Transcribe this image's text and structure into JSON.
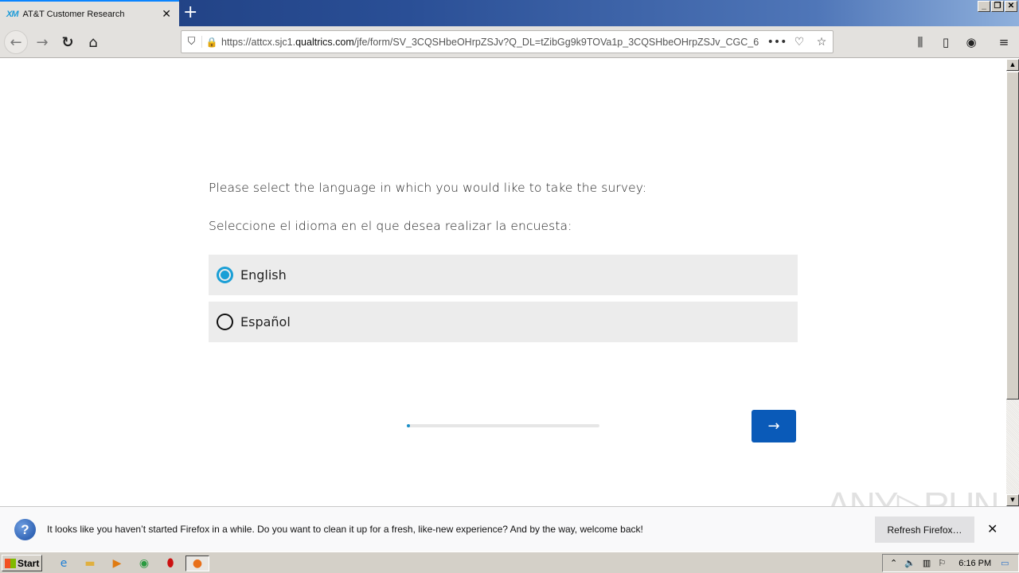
{
  "browser": {
    "tab": {
      "favicon_text": "XM",
      "title": "AT&T Customer Research",
      "close_glyph": "✕"
    },
    "new_tab_glyph": "+",
    "window_controls": {
      "minimize": "_",
      "restore": "❐",
      "close": "✕"
    },
    "nav": {
      "back_glyph": "←",
      "forward_glyph": "→",
      "reload_glyph": "↻",
      "home_glyph": "⌂"
    },
    "url": {
      "prefix": "https://attcx.sjc1.",
      "domain": "qualtrics.com",
      "path": "/jfe/form/SV_3CQSHbeOHrpZSJv?Q_DL=tZibGg9k9TOVa1p_3CQSHbeOHrpZSJv_CGC_6",
      "shield_glyph": "⛉",
      "lock_glyph": "🔒",
      "more_glyph": "•••",
      "pocket_glyph": "♡",
      "star_glyph": "☆"
    },
    "toolbar_right": {
      "library_glyph": "⫼",
      "sidebar_glyph": "▯",
      "account_glyph": "◉",
      "menu_glyph": "≡"
    }
  },
  "survey": {
    "question_en": "Please select the language in which you would like to take the survey:",
    "question_es": "Seleccione el idioma en el que desea realizar la encuesta:",
    "choices": [
      {
        "label": "English",
        "selected": true
      },
      {
        "label": "Español",
        "selected": false
      }
    ],
    "progress_percent": 1,
    "next_glyph": "→",
    "accent_color": "#1a9fd6",
    "button_color": "#0a5ab8"
  },
  "notification": {
    "icon_glyph": "?",
    "message": "It looks like you haven’t started Firefox in a while. Do you want to clean it up for a fresh, like-new experience? And by the way, welcome back!",
    "button_label": "Refresh Firefox…",
    "close_glyph": "✕"
  },
  "watermark": "ANY▷RUN",
  "taskbar": {
    "start_label": "Start",
    "apps": [
      "internet-explorer",
      "file-explorer",
      "media-player",
      "chrome",
      "opera",
      "firefox"
    ],
    "clock": "6:16 PM"
  }
}
